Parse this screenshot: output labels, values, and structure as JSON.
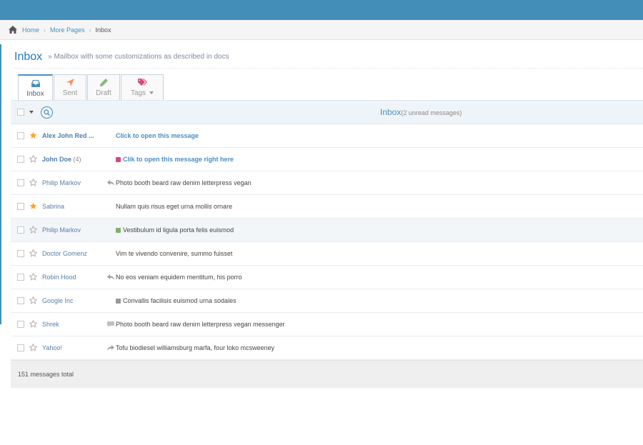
{
  "breadcrumb": {
    "home": "Home",
    "more": "More Pages",
    "current": "Inbox"
  },
  "header": {
    "title": "Inbox",
    "subtitle": "» Mailbox with some customizations as described in docs"
  },
  "tabs": [
    {
      "label": "Inbox",
      "icon": "inbox-icon",
      "color": "#4c8fbd"
    },
    {
      "label": "Sent",
      "icon": "send-icon",
      "color": "#f79263"
    },
    {
      "label": "Draft",
      "icon": "pencil-icon",
      "color": "#87b87f"
    },
    {
      "label": "Tags",
      "icon": "tags-icon",
      "color": "#d6487e"
    }
  ],
  "toolbar": {
    "title": "Inbox",
    "count_note": "(2 unread messages)"
  },
  "messages": [
    {
      "sender": "Alex John Red ...",
      "count": "",
      "subject": "Click to open this message",
      "starred": true,
      "unread": true,
      "label": "",
      "label_color": "",
      "icon": ""
    },
    {
      "sender": "John Doe",
      "count": "(4)",
      "subject": "Clik to open this message right here",
      "starred": false,
      "unread": true,
      "label": "tag",
      "label_color": "#d6487e",
      "icon": ""
    },
    {
      "sender": "Philip Markov",
      "count": "",
      "subject": "Photo booth beard raw denim letterpress vegan",
      "starred": false,
      "unread": false,
      "label": "",
      "label_color": "",
      "icon": "reply-icon"
    },
    {
      "sender": "Sabrina",
      "count": "",
      "subject": "Nullam quis risus eget urna mollis ornare",
      "starred": true,
      "unread": false,
      "label": "",
      "label_color": "",
      "icon": ""
    },
    {
      "sender": "Philip Markov",
      "count": "",
      "subject": "Vestibulum id ligula porta felis euismod",
      "starred": false,
      "unread": false,
      "label": "tag",
      "label_color": "#82af6f",
      "icon": "",
      "highlighted": true
    },
    {
      "sender": "Doctor Gomenz",
      "count": "",
      "subject": "Vim te vivendo convenire, summo fuisset",
      "starred": false,
      "unread": false,
      "label": "",
      "label_color": "",
      "icon": ""
    },
    {
      "sender": "Robin Hood",
      "count": "",
      "subject": "No eos veniam equidem mentitum, his porro",
      "starred": false,
      "unread": false,
      "label": "",
      "label_color": "",
      "icon": "reply-icon"
    },
    {
      "sender": "Google Inc",
      "count": "",
      "subject": "Convallis facilisis euismod urna sodales",
      "starred": false,
      "unread": false,
      "label": "tag",
      "label_color": "#999999",
      "icon": ""
    },
    {
      "sender": "Shrek",
      "count": "",
      "subject": "Photo booth beard raw denim letterpress vegan messenger",
      "starred": false,
      "unread": false,
      "label": "",
      "label_color": "",
      "icon": "comment-icon"
    },
    {
      "sender": "Yahoo!",
      "count": "",
      "subject": "Tofu biodiesel williamsburg marfa, four loko mcsweeney",
      "starred": false,
      "unread": false,
      "label": "",
      "label_color": "",
      "icon": "forward-icon"
    }
  ],
  "footer": {
    "total": "151 messages total"
  },
  "colors": {
    "topbar": "#438eb9",
    "star_on": "#fea62a",
    "star_off": "#a9a9a9",
    "link": "#4c8fbd"
  }
}
